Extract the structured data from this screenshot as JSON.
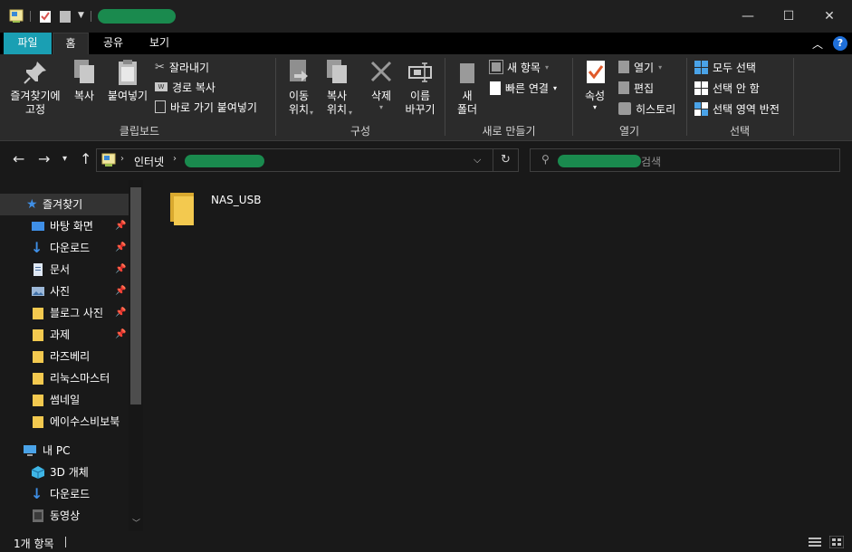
{
  "titlebar": {
    "minimize": "—",
    "maximize": "☐",
    "close": "✕"
  },
  "tabs": [
    {
      "label": "파일"
    },
    {
      "label": "홈"
    },
    {
      "label": "공유"
    },
    {
      "label": "보기"
    }
  ],
  "ribbon": {
    "clipboard": {
      "pin": "즐겨찾기에\n고정",
      "copy": "복사",
      "paste": "붙여넣기",
      "cut": "잘라내기",
      "copy_path": "경로 복사",
      "paste_shortcut": "바로 가기 붙여넣기",
      "label": "클립보드"
    },
    "organize": {
      "move": "이동\n위치",
      "copyto": "복사\n위치",
      "delete": "삭제",
      "rename": "이름\n바꾸기",
      "label": "구성"
    },
    "new": {
      "folder": "새\n폴더",
      "new_item": "새 항목",
      "easy_access": "빠른 연결",
      "label": "새로 만들기"
    },
    "open": {
      "properties": "속성",
      "open": "열기",
      "edit": "편집",
      "history": "히스토리",
      "label": "열기"
    },
    "select": {
      "select_all": "모두 선택",
      "select_none": "선택 안 함",
      "invert": "선택 영역 반전",
      "label": "선택"
    }
  },
  "address": {
    "crumb_root": "인터넷",
    "search_suffix": "검색"
  },
  "navpane": {
    "quick_access": "즐겨찾기",
    "items": [
      {
        "label": "바탕 화면",
        "pinned": true
      },
      {
        "label": "다운로드",
        "pinned": true
      },
      {
        "label": "문서",
        "pinned": true
      },
      {
        "label": "사진",
        "pinned": true
      },
      {
        "label": "블로그 사진",
        "pinned": true
      },
      {
        "label": "과제",
        "pinned": true
      },
      {
        "label": "라즈베리",
        "pinned": false
      },
      {
        "label": "리눅스마스터",
        "pinned": false
      },
      {
        "label": "썸네일",
        "pinned": false
      },
      {
        "label": "에이수스비보북",
        "pinned": false
      }
    ],
    "this_pc": "내 PC",
    "pc_items": [
      {
        "label": "3D 개체"
      },
      {
        "label": "다운로드"
      },
      {
        "label": "동영상"
      }
    ]
  },
  "content": {
    "items": [
      {
        "name": "NAS_USB",
        "icon": "folder-icon"
      }
    ]
  },
  "status": {
    "count": "1개 항목"
  },
  "colors": {
    "file_tab": "#1a9fb3",
    "folder": "#f3c94f",
    "redaction": "#1a8a4e",
    "help": "#1e6fd9"
  }
}
